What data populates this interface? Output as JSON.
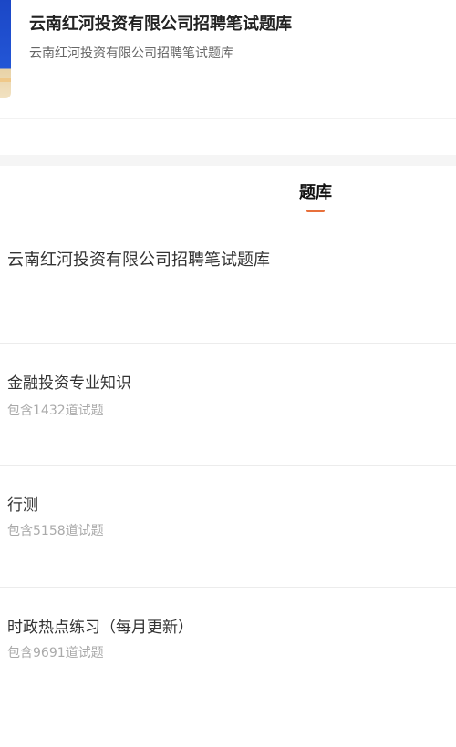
{
  "header": {
    "title": "云南红河投资有限公司招聘笔试题库",
    "subtitle": "云南红河投资有限公司招聘笔试题库"
  },
  "tabs": [
    {
      "label": "题库",
      "active": true
    }
  ],
  "bank_title": "云南红河投资有限公司招聘笔试题库",
  "items": [
    {
      "title": "金融投资专业知识",
      "count": "包含1432道试题"
    },
    {
      "title": "行测",
      "count": "包含5158道试题"
    },
    {
      "title": "时政热点练习（每月更新）",
      "count": "包含9691道试题"
    }
  ],
  "colors": {
    "accent": "#e8703b",
    "cover_blue": "#2356d6"
  }
}
